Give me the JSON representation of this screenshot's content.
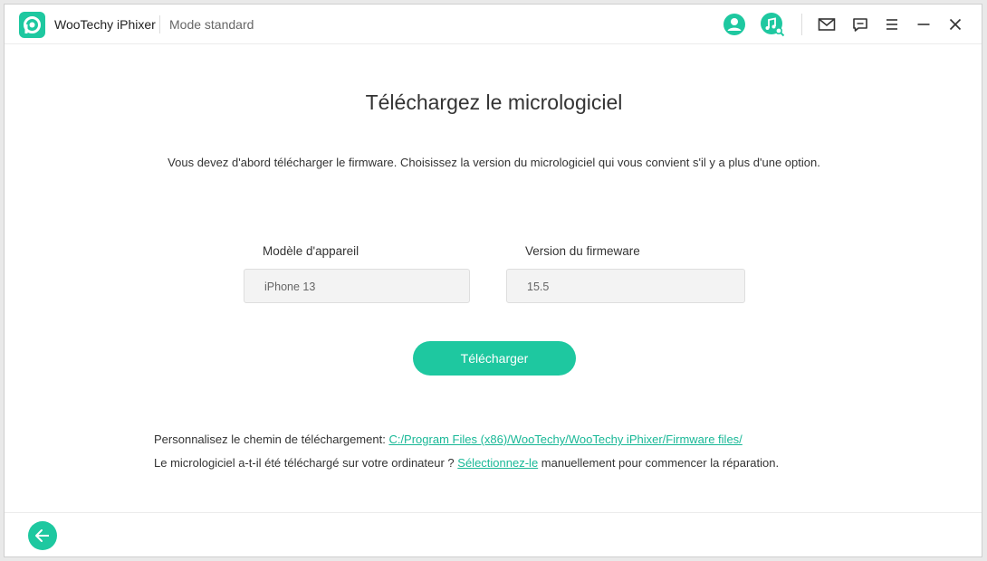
{
  "app": {
    "title": "WooTechy iPhixer",
    "mode": "Mode standard"
  },
  "toolbar_icons": [
    "user-icon",
    "music-search-icon",
    "mail-icon",
    "chat-icon",
    "menu-icon",
    "minimize-icon",
    "close-icon"
  ],
  "main": {
    "heading": "Téléchargez le micrologiciel",
    "subtitle": "Vous devez d'abord télécharger le firmware. Choisissez la version du micrologiciel qui vous convient s'il y a plus d'une option.",
    "device_label": "Modèle d'appareil",
    "device_value": "iPhone 13",
    "firmware_label": "Version du firmeware",
    "firmware_value": "15.5",
    "download_button": "Télécharger",
    "path_prefix": "Personnalisez le chemin de téléchargement: ",
    "path_link": "C:/Program Files (x86)/WooTechy/WooTechy iPhixer/Firmware files/",
    "manual_prefix": "Le micrologiciel a-t-il été téléchargé sur votre ordinateur ? ",
    "manual_link": "Sélectionnez-le",
    "manual_suffix": " manuellement pour commencer la réparation."
  },
  "colors": {
    "accent": "#1ec8a0",
    "link": "#19b897"
  }
}
